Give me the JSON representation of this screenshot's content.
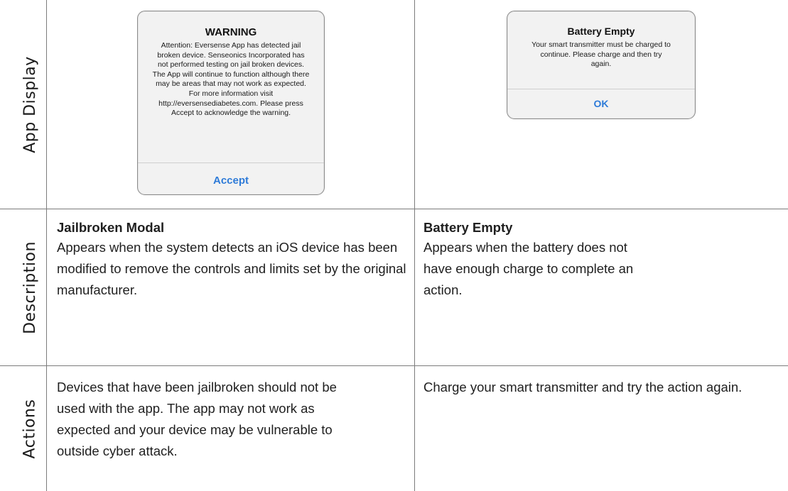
{
  "rows": {
    "display": "App Display",
    "description": "Description",
    "actions": "Actions"
  },
  "jailbroken": {
    "alert_title": "WARNING",
    "alert_message": "Attention: Eversense App has detected jail broken device. Senseonics Incorporated has not performed testing on jail broken devices. The App will continue to function although there may be areas that may not work as expected. For more information visit http://eversensediabetes.com. Please press Accept to acknowledge the warning.",
    "alert_button": "Accept",
    "title": "Jailbroken Modal",
    "description": "Appears when the system detects an iOS device has been modified to remove the controls and limits set by the original manufacturer.",
    "action": "Devices that have been jailbroken should not be used with the app. The app may not work as expected and your device may be vulnerable to outside cyber attack."
  },
  "battery": {
    "alert_title": "Battery Empty",
    "alert_message": "Your smart transmitter must be charged to continue. Please charge and then try again.",
    "alert_button": "OK",
    "title": "Battery Empty",
    "description": "Appears when the battery does not have enough charge to complete an action.",
    "action": "Charge your smart transmitter and try the action again."
  }
}
